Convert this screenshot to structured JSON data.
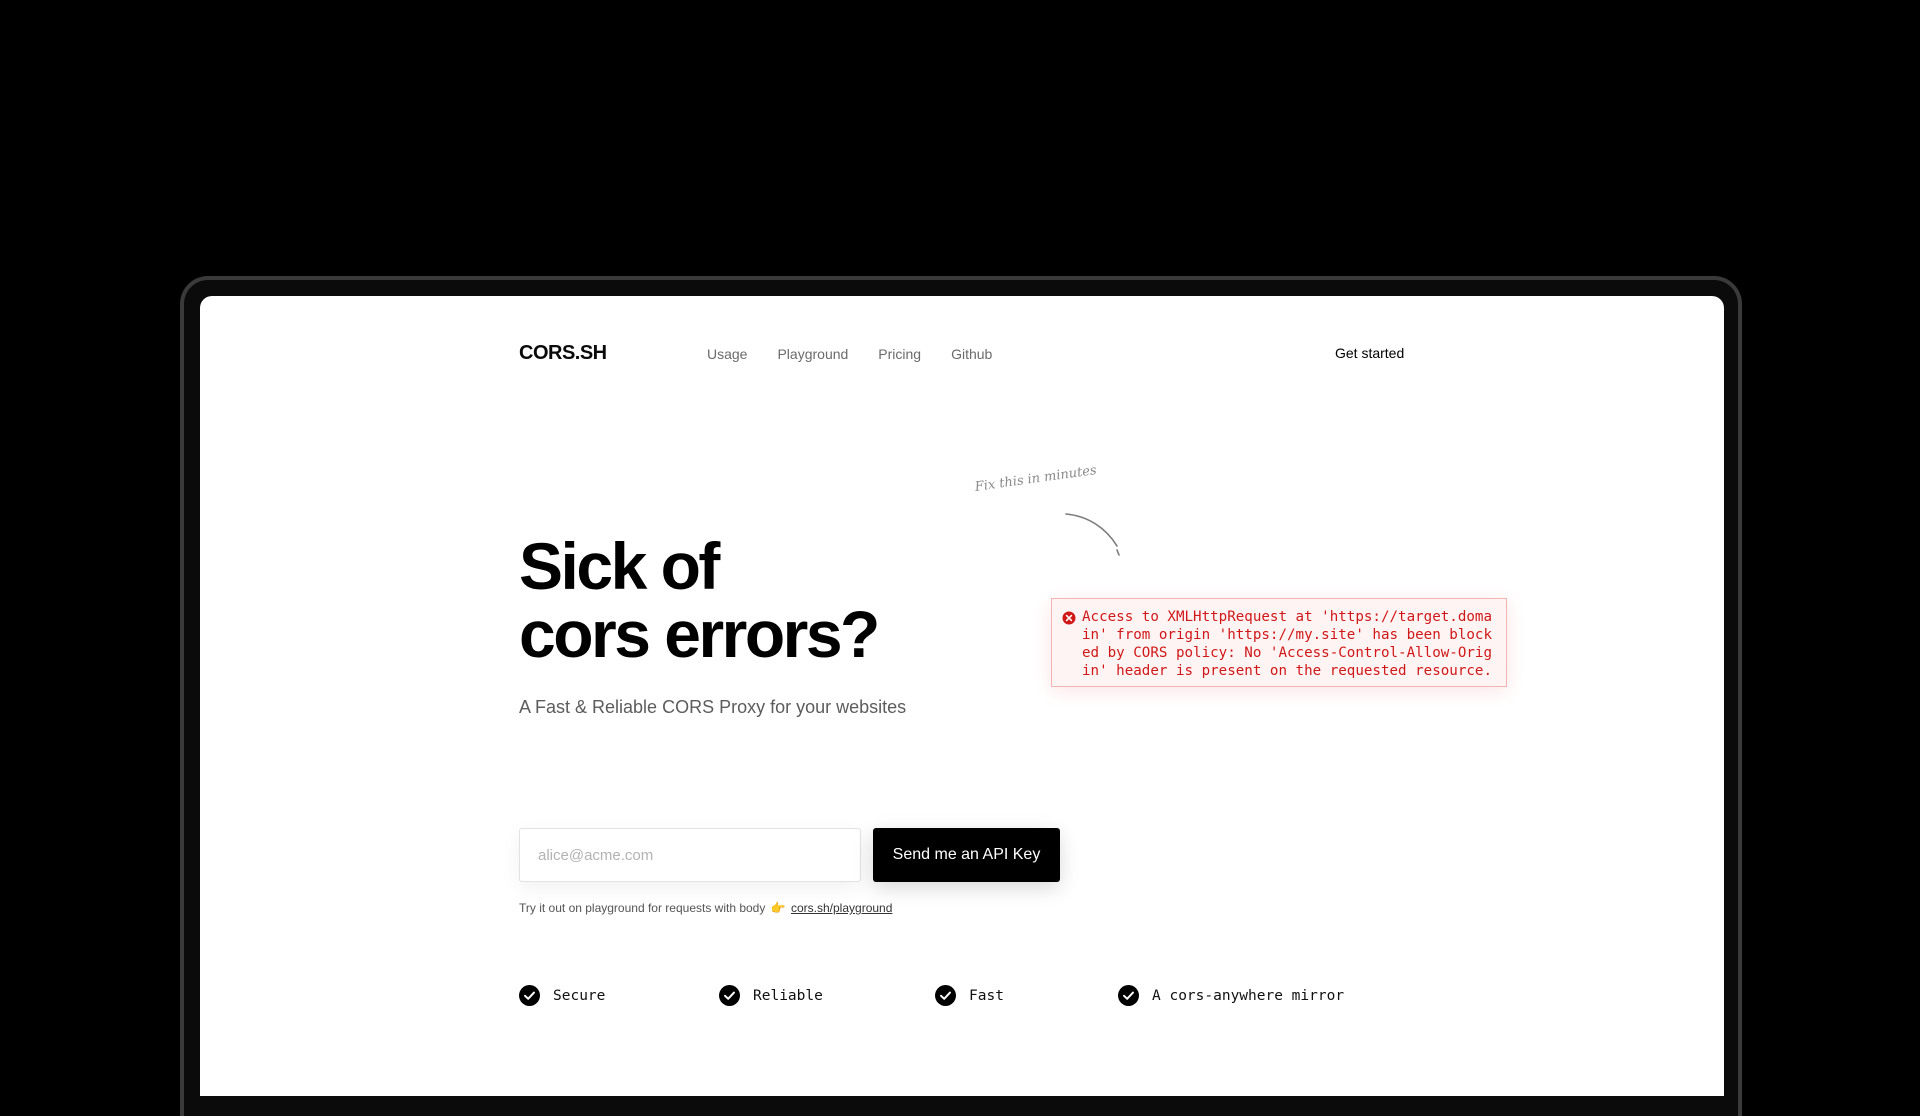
{
  "header": {
    "logo": "CORS.SH",
    "nav": [
      "Usage",
      "Playground",
      "Pricing",
      "Github"
    ],
    "cta": "Get started"
  },
  "hero": {
    "headline_line1": "Sick of",
    "headline_line2": "cors errors?",
    "subheadline": "A Fast & Reliable CORS Proxy for your websites",
    "annotation": "Fix this in minutes"
  },
  "error": {
    "message": "Access to XMLHttpRequest at 'https://target.domain' from origin 'https://my.site' has been blocked by CORS policy: No 'Access-Control-Allow-Origin' header is present on the requested resource.",
    "color": "#d01818"
  },
  "signup": {
    "email_placeholder": "alice@acme.com",
    "email_value": "",
    "button_label": "Send me an API Key",
    "hint_text": "Try it out on playground for requests with body",
    "hint_emoji": "👉",
    "hint_link": "cors.sh/playground"
  },
  "features": [
    "Secure",
    "Reliable",
    "Fast",
    "A cors-anywhere mirror"
  ],
  "icons": {
    "feature_check": "check-circle-icon",
    "error": "error-x-icon",
    "annotation_arrow": "curved-arrow-icon"
  }
}
